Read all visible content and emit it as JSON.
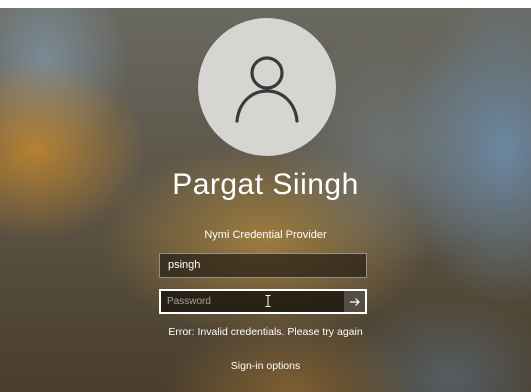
{
  "user": {
    "display_name": "Pargat Siingh",
    "avatar_icon": "person-icon"
  },
  "login": {
    "provider": "Nymi Credential Provider",
    "username_value": "psingh",
    "password_placeholder": "Password",
    "submit_icon": "arrow-right-icon",
    "error_message": "Error: Invalid credentials. Please try again",
    "sign_in_options": "Sign-in options"
  },
  "colors": {
    "avatar_bg": "#d6d5d1",
    "avatar_figure": "#3a3a3a",
    "text": "#ffffff"
  }
}
